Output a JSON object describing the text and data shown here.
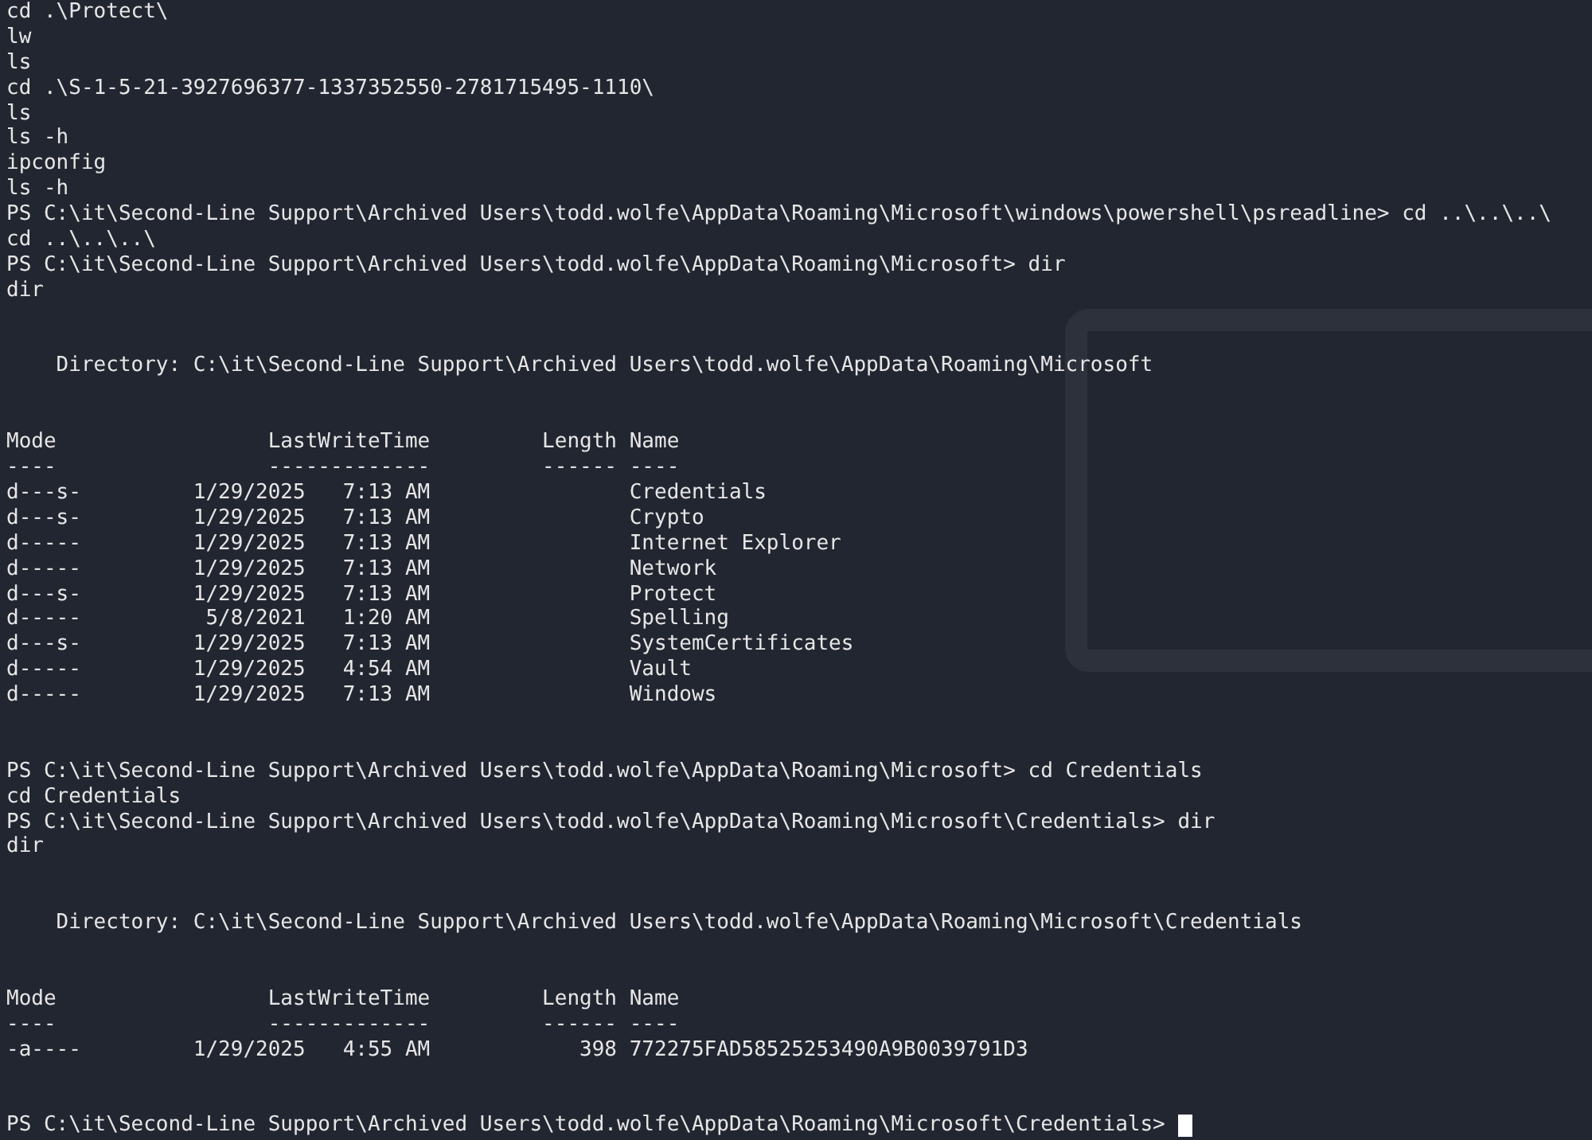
{
  "terminal": {
    "cursor_visible": true,
    "blocks": [
      {
        "lines": [
          "cd .\\Protect\\",
          "lw",
          "ls",
          "cd .\\S-1-5-21-3927696377-1337352550-2781715495-1110\\",
          "ls",
          "ls -h",
          "ipconfig",
          "ls -h",
          "PS C:\\it\\Second-Line Support\\Archived Users\\todd.wolfe\\AppData\\Roaming\\Microsoft\\windows\\powershell\\psreadline> cd ..\\..\\..\\",
          "cd ..\\..\\..\\",
          "PS C:\\it\\Second-Line Support\\Archived Users\\todd.wolfe\\AppData\\Roaming\\Microsoft> dir",
          "dir"
        ]
      },
      {
        "lines": [
          "    Directory: C:\\it\\Second-Line Support\\Archived Users\\todd.wolfe\\AppData\\Roaming\\Microsoft"
        ]
      },
      {
        "lines": [
          "Mode                 LastWriteTime         Length Name",
          "----                 -------------         ------ ----",
          "d---s-         1/29/2025   7:13 AM                Credentials",
          "d---s-         1/29/2025   7:13 AM                Crypto",
          "d-----         1/29/2025   7:13 AM                Internet Explorer",
          "d-----         1/29/2025   7:13 AM                Network",
          "d---s-         1/29/2025   7:13 AM                Protect",
          "d-----          5/8/2021   1:20 AM                Spelling",
          "d---s-         1/29/2025   7:13 AM                SystemCertificates",
          "d-----         1/29/2025   4:54 AM                Vault",
          "d-----         1/29/2025   7:13 AM                Windows"
        ]
      },
      {
        "lines": [
          "PS C:\\it\\Second-Line Support\\Archived Users\\todd.wolfe\\AppData\\Roaming\\Microsoft> cd Credentials",
          "cd Credentials",
          "PS C:\\it\\Second-Line Support\\Archived Users\\todd.wolfe\\AppData\\Roaming\\Microsoft\\Credentials> dir",
          "dir"
        ]
      },
      {
        "lines": [
          "    Directory: C:\\it\\Second-Line Support\\Archived Users\\todd.wolfe\\AppData\\Roaming\\Microsoft\\Credentials"
        ]
      },
      {
        "lines": [
          "Mode                 LastWriteTime         Length Name",
          "----                 -------------         ------ ----",
          "-a----         1/29/2025   4:55 AM            398 772275FAD58525253490A9B0039791D3"
        ]
      },
      {
        "lines": [
          "PS C:\\it\\Second-Line Support\\Archived Users\\todd.wolfe\\AppData\\Roaming\\Microsoft\\Credentials> "
        ]
      }
    ]
  }
}
